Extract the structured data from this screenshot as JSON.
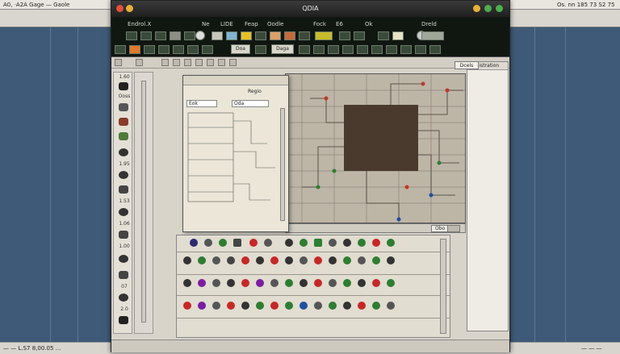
{
  "desktop": {
    "top_left": "A0, ·A2A Gage — Gaole",
    "top_right": "Os. nn 185 73 S2 75 ‹.",
    "bottom_left": "— — L.S7 8,00.05 ...",
    "bottom_right": "— — —"
  },
  "window": {
    "title": "QDIA",
    "menu": [
      "Endrol.X",
      "Ne",
      "LIDE",
      "Feap",
      "Oodle",
      "Fock",
      "E6",
      "Ok",
      "Dreld"
    ],
    "tool_label_a": "Doa",
    "tool_label_b": "Daga",
    "colors": {
      "menubar": "#101610",
      "canvas_bg": "#b9b0a1",
      "close": "#e2503c",
      "minimize": "#e6b13a",
      "zoom": "#4caf50"
    }
  },
  "palette": {
    "labels": [
      "1.60",
      "Ooss",
      "1.95",
      "1.53",
      "1.06",
      "1.00",
      "07",
      "2.0"
    ]
  },
  "inspector": {
    "title_label": "Regio",
    "field_a": "Eok",
    "field_b": "Oda"
  },
  "right_panel": {
    "dock_label": "Dcels",
    "header": "Registration"
  },
  "canvas": {
    "footer_button": "Obo"
  }
}
